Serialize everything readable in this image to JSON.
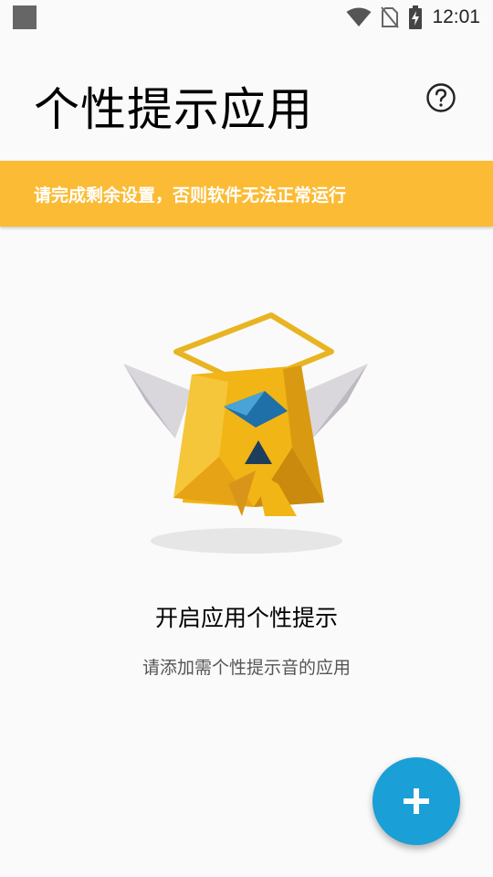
{
  "status_bar": {
    "time": "12:01",
    "icons": [
      "notification-square-icon",
      "wifi-icon",
      "no-sim-icon",
      "battery-charging-icon"
    ]
  },
  "header": {
    "title": "个性提示应用",
    "help_icon": "question-circle-icon"
  },
  "banner": {
    "text": "请完成剩余设置，否则软件无法正常运行",
    "color": "#fbbb34"
  },
  "empty_state": {
    "illustration": "golden-mascot-with-halo",
    "title": "开启应用个性提示",
    "subtitle": "请添加需个性提示音的应用"
  },
  "fab": {
    "icon": "plus-icon",
    "color": "#1a9fd6"
  }
}
